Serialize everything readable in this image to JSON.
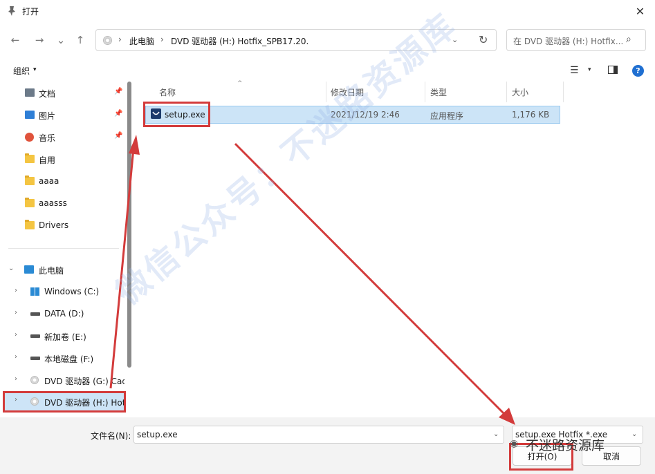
{
  "window": {
    "title": "打开",
    "close": "✕"
  },
  "nav": {
    "back": "←",
    "forward": "→",
    "recent": "⌄",
    "up": "↑"
  },
  "address": {
    "crumbs": [
      "此电脑",
      "DVD 驱动器 (H:) Hotfix_SPB17.20."
    ],
    "sep": "›",
    "dropdown": "⌄",
    "refresh": "↻"
  },
  "search": {
    "placeholder": "在 DVD 驱动器 (H:) Hotfix...",
    "icon": "⌕"
  },
  "toolbar": {
    "organize": "组织",
    "caret": "▾",
    "view": "☰",
    "help": "?"
  },
  "sidebar": {
    "quick": [
      {
        "label": "文档",
        "icon": "document-icon"
      },
      {
        "label": "图片",
        "icon": "picture-icon"
      },
      {
        "label": "音乐",
        "icon": "music-icon"
      },
      {
        "label": "自用",
        "icon": "folder-icon"
      },
      {
        "label": "aaaa",
        "icon": "folder-icon"
      },
      {
        "label": "aaasss",
        "icon": "folder-icon"
      },
      {
        "label": "Drivers",
        "icon": "folder-icon"
      }
    ],
    "pin": "📌",
    "this_pc": "此电脑",
    "drives": [
      {
        "label": "Windows (C:)"
      },
      {
        "label": "DATA (D:)"
      },
      {
        "label": "新加卷 (E:)"
      },
      {
        "label": "本地磁盘 (F:)"
      },
      {
        "label": "DVD 驱动器 (G:) Cad"
      },
      {
        "label": "DVD 驱动器 (H:) Hot"
      }
    ],
    "chev_right": "›",
    "chev_down": "⌄"
  },
  "filelist": {
    "columns": [
      "名称",
      "修改日期",
      "类型",
      "大小"
    ],
    "sort_arrow": "^",
    "rows": [
      {
        "name": "setup.exe",
        "modified": "2021/12/19 2:46",
        "type": "应用程序",
        "size": "1,176 KB"
      }
    ]
  },
  "bottom": {
    "filename_label": "文件名(N):",
    "filename_value": "setup.exe",
    "filetype_value": "setup.exe Hotfix *.exe",
    "open": "打开(O)",
    "cancel": "取消"
  },
  "watermark": {
    "text": "微信公众号：不迷路资源库",
    "corner": "不迷路资源库"
  },
  "colors": {
    "annotation": "#d33b3b",
    "selection": "#cce4f7",
    "accent": "#1f6fd1"
  }
}
